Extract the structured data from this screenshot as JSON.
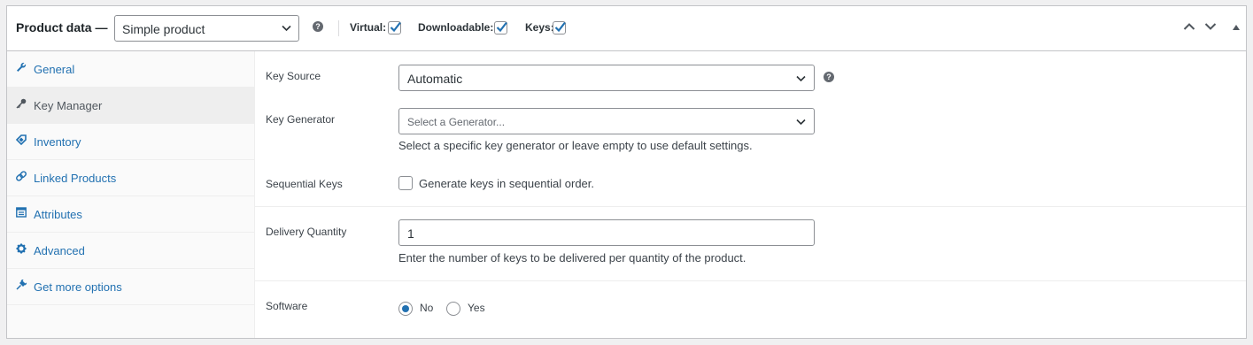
{
  "header": {
    "title": "Product data —",
    "product_type": "Simple product",
    "help_glyph": "?",
    "options": {
      "virtual": {
        "label": "Virtual:",
        "checked": true
      },
      "downloadable": {
        "label": "Downloadable:",
        "checked": true
      },
      "keys": {
        "label": "Keys:",
        "checked": true
      }
    },
    "icons": [
      "chevron-up-icon",
      "chevron-down-icon",
      "collapse-triangle-icon"
    ]
  },
  "tabs": [
    {
      "label": "General",
      "icon": "wrench-icon",
      "active": false
    },
    {
      "label": "Key Manager",
      "icon": "key-icon",
      "active": true
    },
    {
      "label": "Inventory",
      "icon": "tag-icon",
      "active": false
    },
    {
      "label": "Linked Products",
      "icon": "link-icon",
      "active": false
    },
    {
      "label": "Attributes",
      "icon": "list-icon",
      "active": false
    },
    {
      "label": "Advanced",
      "icon": "gear-icon",
      "active": false
    },
    {
      "label": "Get more options",
      "icon": "plugin-icon",
      "active": false
    }
  ],
  "fields": {
    "key_source": {
      "label": "Key Source",
      "value": "Automatic"
    },
    "key_generator": {
      "label": "Key Generator",
      "placeholder": "Select a Generator...",
      "description": "Select a specific key generator or leave empty to use default settings."
    },
    "sequential_keys": {
      "label": "Sequential Keys",
      "checkbox_label": "Generate keys in sequential order.",
      "checked": false
    },
    "delivery_quantity": {
      "label": "Delivery Quantity",
      "value": "1",
      "description": "Enter the number of keys to be delivered per quantity of the product."
    },
    "software": {
      "label": "Software",
      "options": [
        {
          "label": "No",
          "selected": true
        },
        {
          "label": "Yes",
          "selected": false
        }
      ]
    }
  },
  "colors": {
    "accent": "#2271b1",
    "text": "#3c434a",
    "border": "#8c8f94"
  }
}
